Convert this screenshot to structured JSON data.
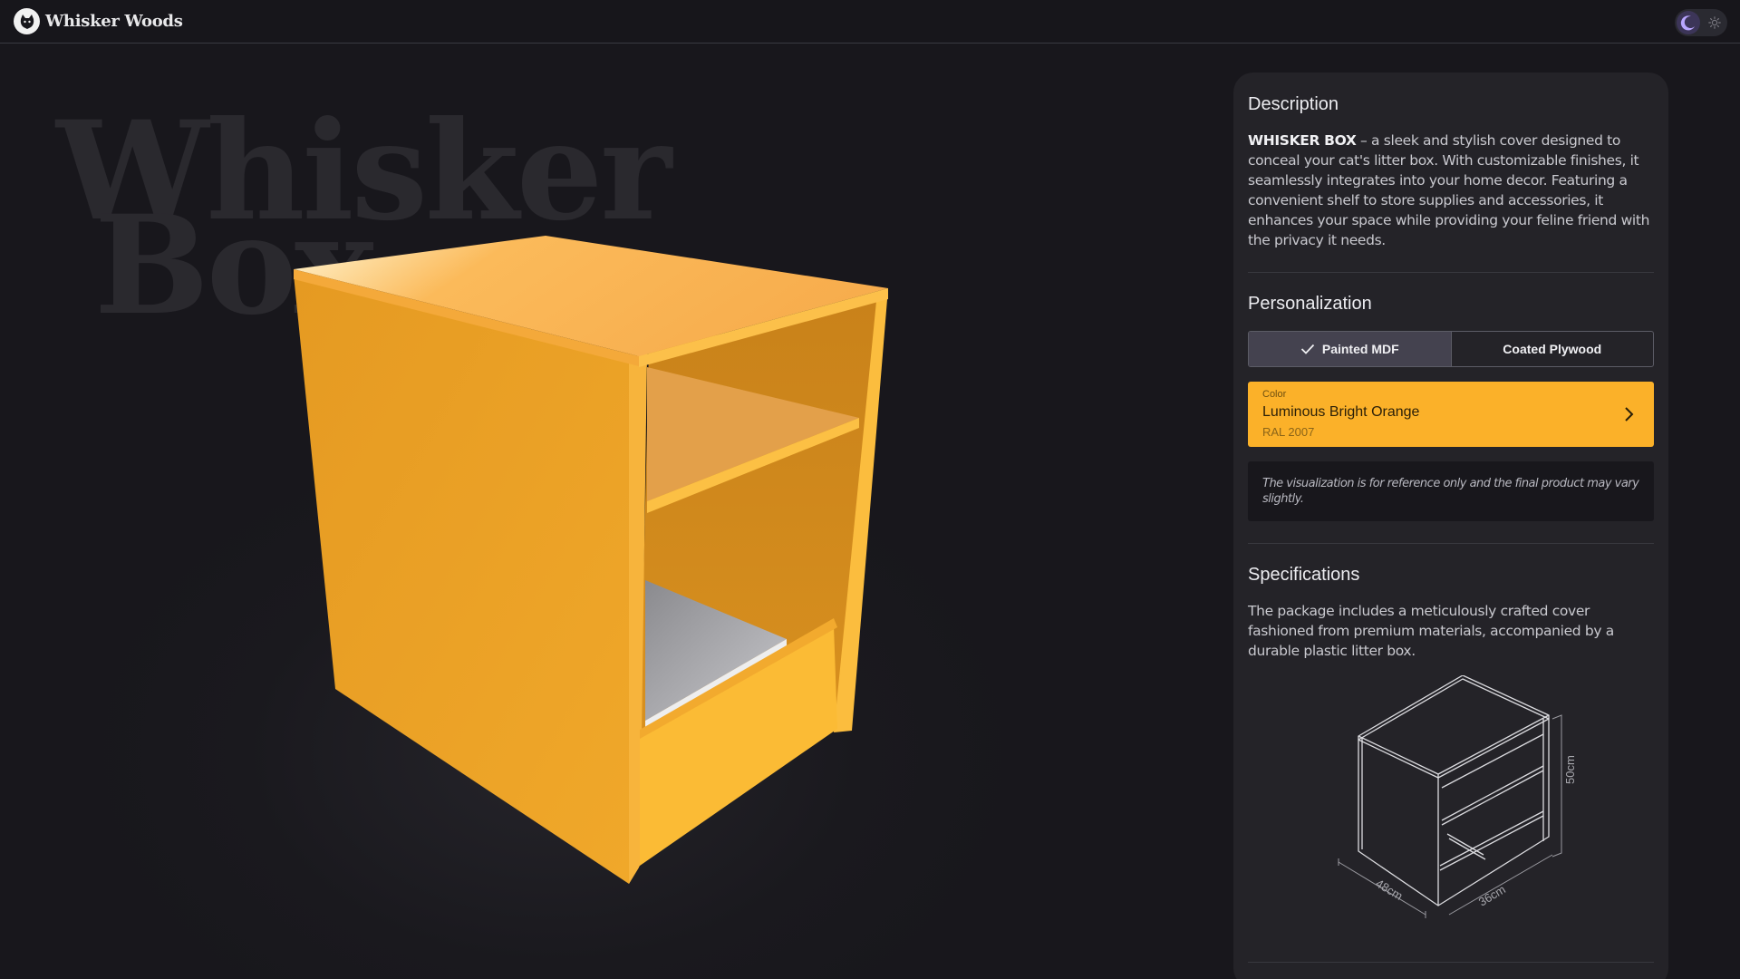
{
  "app": {
    "brand": "Whisker Woods",
    "logo_icon": "cat-logo-icon",
    "theme": {
      "mode": "dark",
      "moon_icon": "moon-icon",
      "sun_icon": "sun-icon"
    }
  },
  "hero": {
    "title_line1": "Whisker",
    "title_line2": "Box",
    "product_color": "#fbb129"
  },
  "panel": {
    "description": {
      "title": "Description",
      "product_name": "WHISKER BOX",
      "text": " – a sleek and stylish cover designed to conceal your cat's litter box. With customizable finishes, it seamlessly integrates into your home decor. Featuring a convenient shelf to store supplies and accessories, it enhances your space while providing your feline friend with the privacy it needs."
    },
    "personalization": {
      "title": "Personalization",
      "materials": [
        {
          "label": "Painted MDF",
          "selected": true
        },
        {
          "label": "Coated Plywood",
          "selected": false
        }
      ],
      "color": {
        "label": "Color",
        "name": "Luminous Bright Orange",
        "code": "RAL 2007",
        "swatch": "#fbb129"
      },
      "note": "The visualization is for reference only and the final product may vary slightly."
    },
    "specifications": {
      "title": "Specifications",
      "text": "The package includes a meticulously crafted cover fashioned from premium materials, accompanied by a durable plastic litter box.",
      "dimensions": {
        "height": "50cm",
        "width": "48cm",
        "depth": "36cm"
      }
    }
  }
}
